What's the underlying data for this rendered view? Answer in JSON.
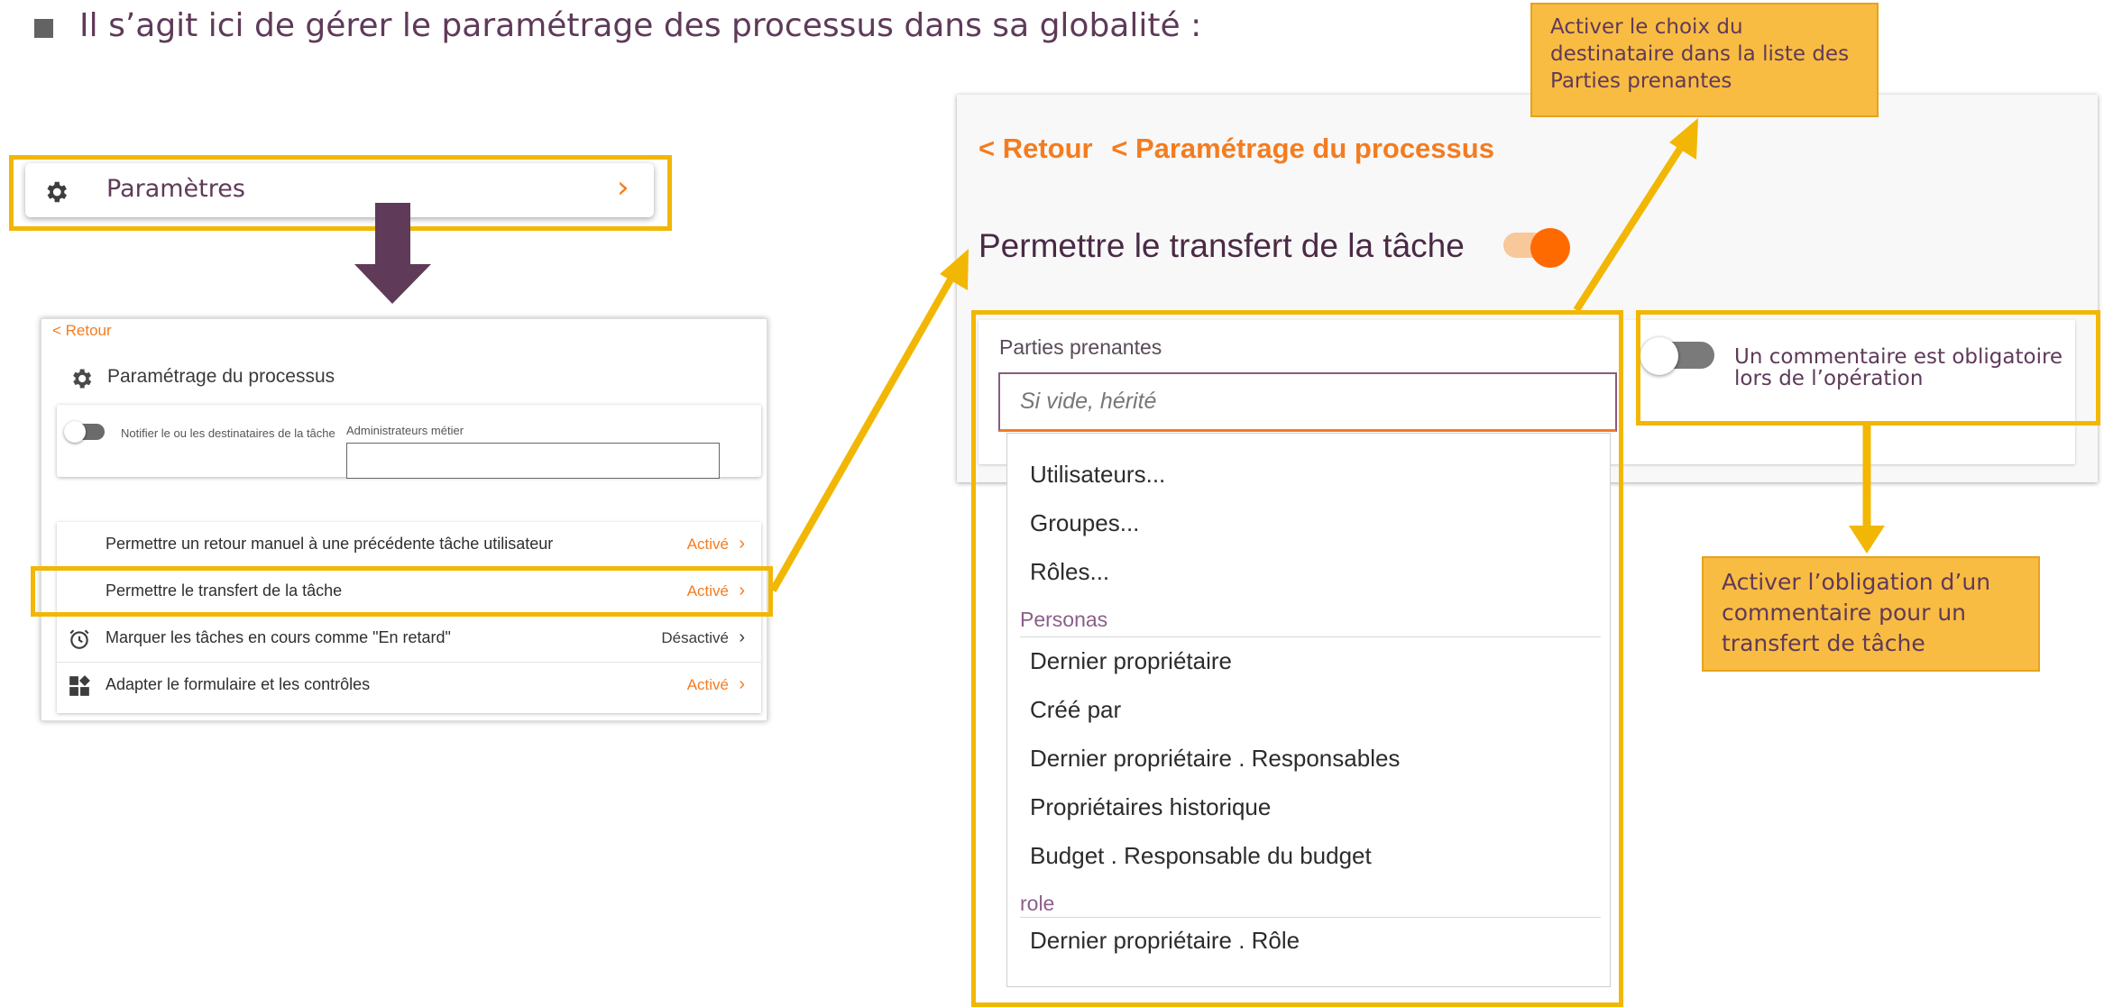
{
  "header": {
    "headline": "Il s’agit ici de gérer le paramétrage des processus dans sa globalité :"
  },
  "settings_item": {
    "label": "Paramètres",
    "chevron": "›",
    "icon": "gear-icon"
  },
  "panel_process": {
    "back": "< Retour",
    "title": "Paramétrage du processus",
    "notify_label": "Notifier le ou les destinataires de la tâche",
    "admin_label": "Administrateurs métier",
    "admin_value": "",
    "rows": [
      {
        "label": "Permettre un retour manuel à une précédente tâche utilisateur",
        "status": "Activé",
        "chevron": "›",
        "state": "on"
      },
      {
        "label": "Permettre le transfert de la tâche",
        "status": "Activé",
        "chevron": "›",
        "state": "on"
      },
      {
        "label": "Marquer les tâches en cours comme \"En retard\"",
        "status": "Désactivé",
        "chevron": "›",
        "state": "off"
      },
      {
        "label": "Adapter le formulaire et les contrôles",
        "status": "Activé",
        "chevron": "›",
        "state": "on"
      }
    ]
  },
  "panel_transfer": {
    "back": "< Retour",
    "back_process": "< Paramétrage du processus",
    "title": "Permettre le transfert de la tâche",
    "stakeholders_label": "Parties prenantes",
    "stakeholders_placeholder": "Si vide, hérité",
    "comment_label": "Un commentaire est obligatoire lors de l’opération"
  },
  "dropdown": {
    "items": [
      "Utilisateurs...",
      "Groupes...",
      "Rôles..."
    ],
    "group_personas": "Personas",
    "personas": [
      "Dernier propriétaire",
      "Créé par",
      "Dernier propriétaire . Responsables",
      "Propriétaires historique",
      "Budget . Responsable du budget"
    ],
    "group_role": "role",
    "roles": [
      "Dernier propriétaire . Rôle"
    ]
  },
  "callouts": {
    "stakeholders": "Activer le choix du destinataire dans la liste des Parties prenantes",
    "comment": "Activer l’obligation d’un commentaire pour un transfert de tâche"
  },
  "colors": {
    "highlight": "#f2b705",
    "accent": "#f47c20",
    "title_purple": "#5f3a59",
    "callout_bg": "#f9bc42"
  }
}
